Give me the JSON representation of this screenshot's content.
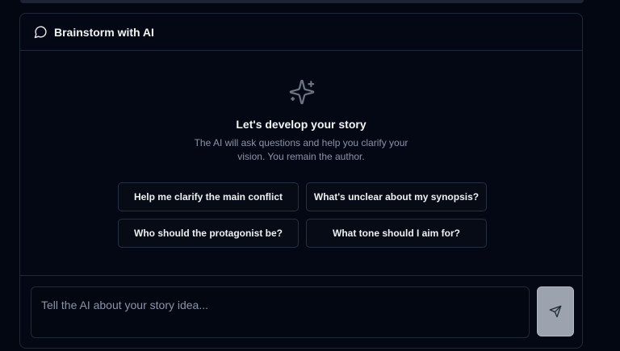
{
  "panel": {
    "title": "Brainstorm with AI",
    "header_icon": "message-circle-icon"
  },
  "empty_state": {
    "icon": "sparkles-icon",
    "heading": "Let's develop your story",
    "description": "The AI will ask questions and help you clarify your vision. You remain the author."
  },
  "suggestions": [
    "Help me clarify the main conflict",
    "What's unclear about my synopsis?",
    "Who should the protagonist be?",
    "What tone should I aim for?"
  ],
  "input": {
    "placeholder": "Tell the AI about your story idea...",
    "value": ""
  },
  "send_button": {
    "icon": "send-icon"
  },
  "colors": {
    "background": "#030712",
    "panel_border": "#1f2937",
    "send_button_bg": "#9ca3af",
    "muted_text": "#8b94a6"
  }
}
